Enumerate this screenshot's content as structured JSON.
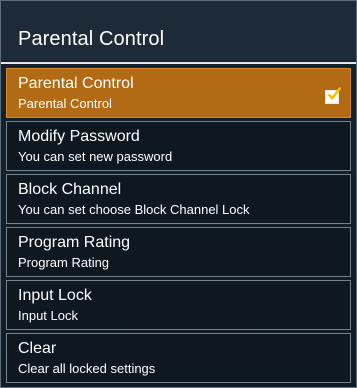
{
  "header": {
    "title": "Parental Control"
  },
  "menu": {
    "items": [
      {
        "title": "Parental Control",
        "description": "Parental Control",
        "selected": true,
        "checked": true
      },
      {
        "title": "Modify Password",
        "description": "You can set new password"
      },
      {
        "title": "Block Channel",
        "description": "You can set choose Block Channel Lock"
      },
      {
        "title": "Program Rating",
        "description": "Program Rating"
      },
      {
        "title": "Input Lock",
        "description": "Input Lock"
      },
      {
        "title": "Clear",
        "description": "Clear all locked settings"
      }
    ]
  },
  "colors": {
    "selected_background": "#b26a14",
    "panel_background": "#101b24",
    "title_background": "#1c2b37",
    "check_mark": "#f2c400"
  },
  "icons": {
    "checkbox": "checkmark-icon"
  }
}
